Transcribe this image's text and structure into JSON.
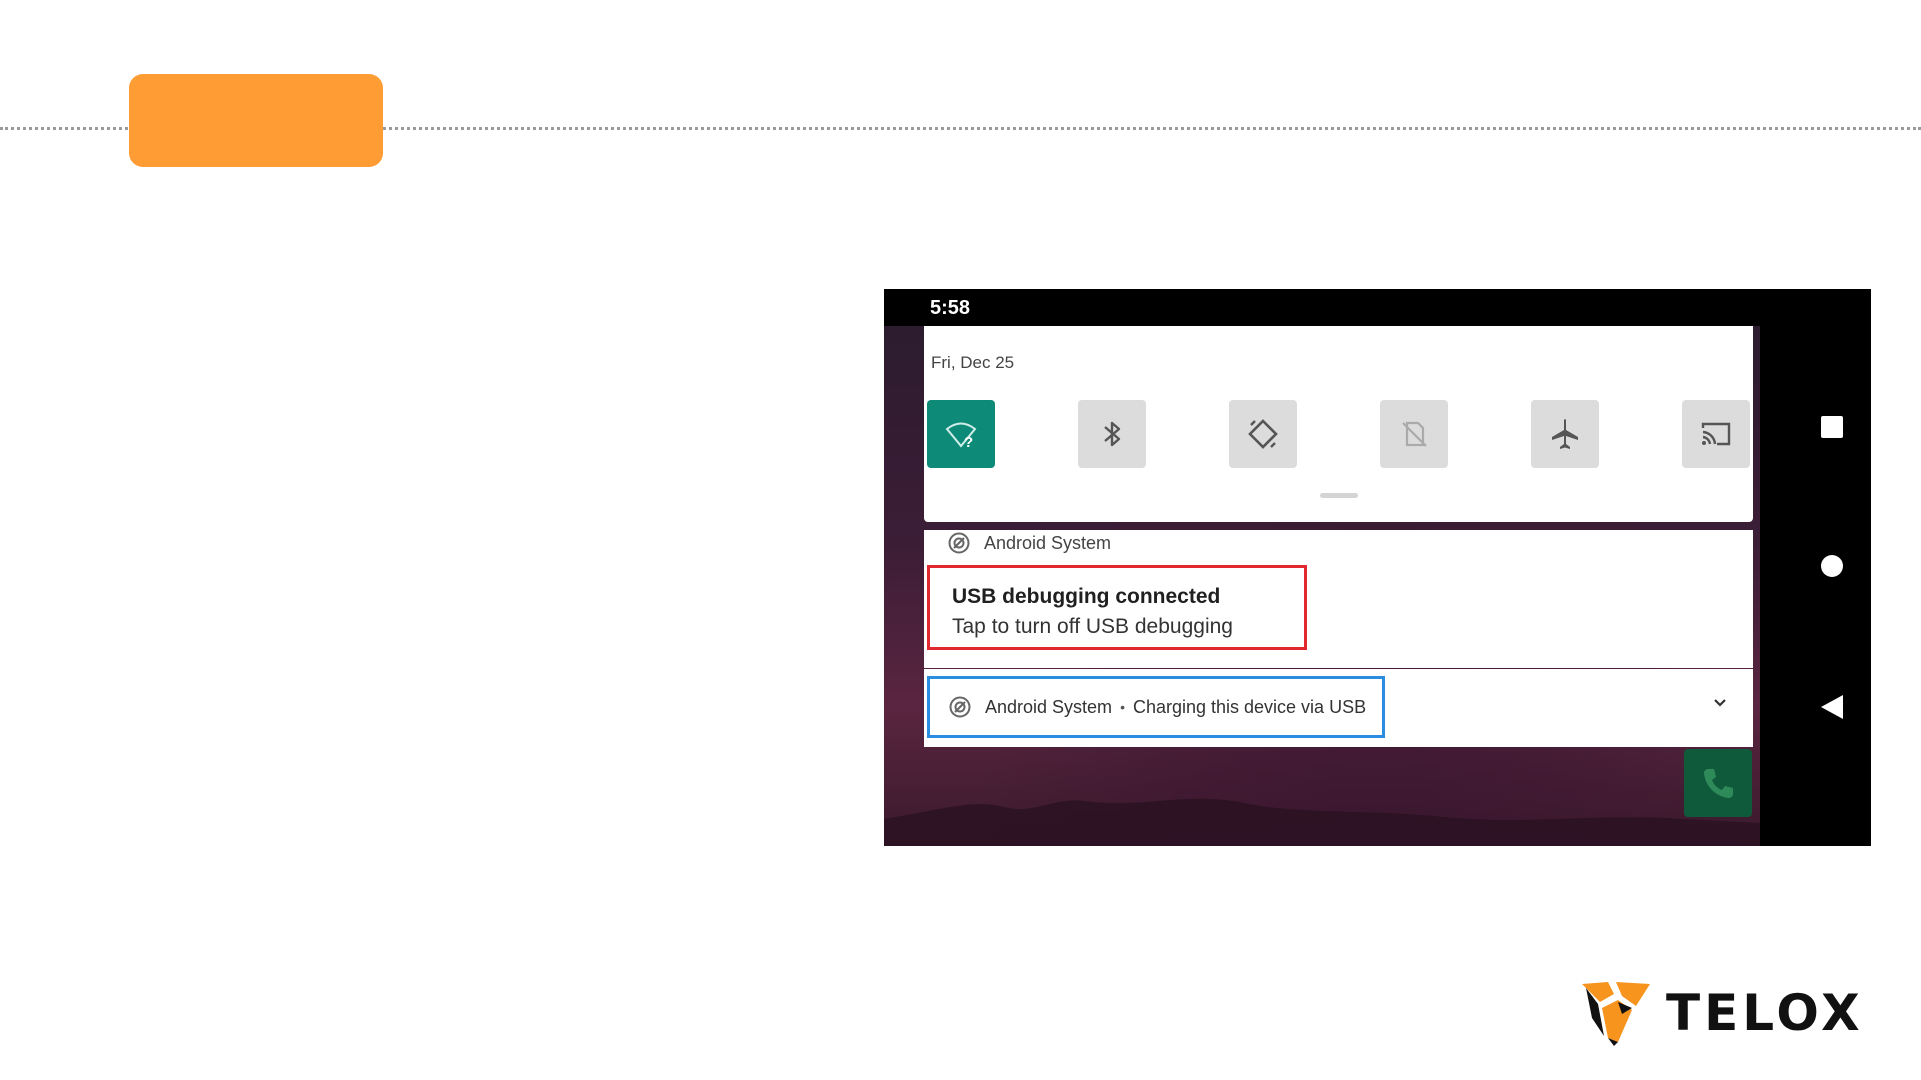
{
  "slide": {
    "accent_color": "#ff9c33"
  },
  "device": {
    "status_time": "5:58",
    "quick_settings": {
      "date": "Fri, Dec 25",
      "tiles": [
        {
          "icon": "wifi-unknown-icon",
          "active": true
        },
        {
          "icon": "bluetooth-icon",
          "active": false
        },
        {
          "icon": "auto-rotate-icon",
          "active": false
        },
        {
          "icon": "no-sim-icon",
          "active": false
        },
        {
          "icon": "airplane-mode-icon",
          "active": false
        },
        {
          "icon": "cast-icon",
          "active": false
        }
      ]
    },
    "notifications": [
      {
        "app": "Android System",
        "title": "USB debugging connected",
        "text": "Tap to turn off USB debugging"
      },
      {
        "app": "Android System",
        "separator": "•",
        "text": "Charging this device via USB"
      }
    ],
    "nav_buttons": [
      "recents-icon",
      "home-icon",
      "back-icon"
    ]
  },
  "brand": {
    "name": "TELOX",
    "colors": {
      "orange": "#f7941d",
      "dark": "#111111"
    }
  }
}
